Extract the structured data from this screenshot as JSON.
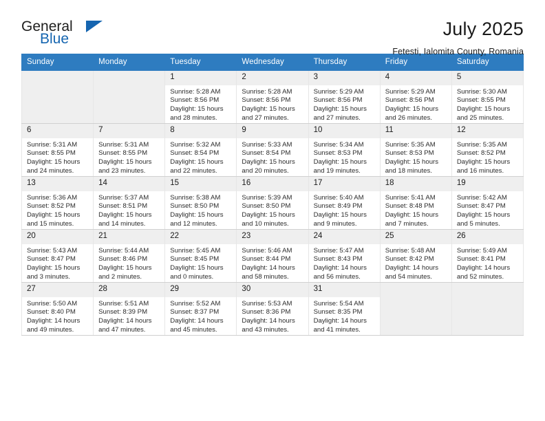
{
  "brand": {
    "line1": "General",
    "line2": "Blue",
    "flag_icon": "triangle-flag-icon",
    "accent_color": "#1565b0"
  },
  "header": {
    "month_title": "July 2025",
    "location": "Fetesti, Ialomita County, Romania"
  },
  "calendar": {
    "header_bg": "#2e7cc0",
    "header_text_color": "#ffffff",
    "weekday_headers": [
      "Sunday",
      "Monday",
      "Tuesday",
      "Wednesday",
      "Thursday",
      "Friday",
      "Saturday"
    ],
    "labels": {
      "sunrise_prefix": "Sunrise:",
      "sunset_prefix": "Sunset:",
      "daylight_prefix": "Daylight:"
    },
    "weeks": [
      [
        {
          "day": "",
          "empty": true
        },
        {
          "day": "",
          "empty": true
        },
        {
          "day": "1",
          "sunrise": "Sunrise: 5:28 AM",
          "sunset": "Sunset: 8:56 PM",
          "daylight_line1": "Daylight: 15 hours",
          "daylight_line2": "and 28 minutes."
        },
        {
          "day": "2",
          "sunrise": "Sunrise: 5:28 AM",
          "sunset": "Sunset: 8:56 PM",
          "daylight_line1": "Daylight: 15 hours",
          "daylight_line2": "and 27 minutes."
        },
        {
          "day": "3",
          "sunrise": "Sunrise: 5:29 AM",
          "sunset": "Sunset: 8:56 PM",
          "daylight_line1": "Daylight: 15 hours",
          "daylight_line2": "and 27 minutes."
        },
        {
          "day": "4",
          "sunrise": "Sunrise: 5:29 AM",
          "sunset": "Sunset: 8:56 PM",
          "daylight_line1": "Daylight: 15 hours",
          "daylight_line2": "and 26 minutes."
        },
        {
          "day": "5",
          "sunrise": "Sunrise: 5:30 AM",
          "sunset": "Sunset: 8:55 PM",
          "daylight_line1": "Daylight: 15 hours",
          "daylight_line2": "and 25 minutes."
        }
      ],
      [
        {
          "day": "6",
          "sunrise": "Sunrise: 5:31 AM",
          "sunset": "Sunset: 8:55 PM",
          "daylight_line1": "Daylight: 15 hours",
          "daylight_line2": "and 24 minutes."
        },
        {
          "day": "7",
          "sunrise": "Sunrise: 5:31 AM",
          "sunset": "Sunset: 8:55 PM",
          "daylight_line1": "Daylight: 15 hours",
          "daylight_line2": "and 23 minutes."
        },
        {
          "day": "8",
          "sunrise": "Sunrise: 5:32 AM",
          "sunset": "Sunset: 8:54 PM",
          "daylight_line1": "Daylight: 15 hours",
          "daylight_line2": "and 22 minutes."
        },
        {
          "day": "9",
          "sunrise": "Sunrise: 5:33 AM",
          "sunset": "Sunset: 8:54 PM",
          "daylight_line1": "Daylight: 15 hours",
          "daylight_line2": "and 20 minutes."
        },
        {
          "day": "10",
          "sunrise": "Sunrise: 5:34 AM",
          "sunset": "Sunset: 8:53 PM",
          "daylight_line1": "Daylight: 15 hours",
          "daylight_line2": "and 19 minutes."
        },
        {
          "day": "11",
          "sunrise": "Sunrise: 5:35 AM",
          "sunset": "Sunset: 8:53 PM",
          "daylight_line1": "Daylight: 15 hours",
          "daylight_line2": "and 18 minutes."
        },
        {
          "day": "12",
          "sunrise": "Sunrise: 5:35 AM",
          "sunset": "Sunset: 8:52 PM",
          "daylight_line1": "Daylight: 15 hours",
          "daylight_line2": "and 16 minutes."
        }
      ],
      [
        {
          "day": "13",
          "sunrise": "Sunrise: 5:36 AM",
          "sunset": "Sunset: 8:52 PM",
          "daylight_line1": "Daylight: 15 hours",
          "daylight_line2": "and 15 minutes."
        },
        {
          "day": "14",
          "sunrise": "Sunrise: 5:37 AM",
          "sunset": "Sunset: 8:51 PM",
          "daylight_line1": "Daylight: 15 hours",
          "daylight_line2": "and 14 minutes."
        },
        {
          "day": "15",
          "sunrise": "Sunrise: 5:38 AM",
          "sunset": "Sunset: 8:50 PM",
          "daylight_line1": "Daylight: 15 hours",
          "daylight_line2": "and 12 minutes."
        },
        {
          "day": "16",
          "sunrise": "Sunrise: 5:39 AM",
          "sunset": "Sunset: 8:50 PM",
          "daylight_line1": "Daylight: 15 hours",
          "daylight_line2": "and 10 minutes."
        },
        {
          "day": "17",
          "sunrise": "Sunrise: 5:40 AM",
          "sunset": "Sunset: 8:49 PM",
          "daylight_line1": "Daylight: 15 hours",
          "daylight_line2": "and 9 minutes."
        },
        {
          "day": "18",
          "sunrise": "Sunrise: 5:41 AM",
          "sunset": "Sunset: 8:48 PM",
          "daylight_line1": "Daylight: 15 hours",
          "daylight_line2": "and 7 minutes."
        },
        {
          "day": "19",
          "sunrise": "Sunrise: 5:42 AM",
          "sunset": "Sunset: 8:47 PM",
          "daylight_line1": "Daylight: 15 hours",
          "daylight_line2": "and 5 minutes."
        }
      ],
      [
        {
          "day": "20",
          "sunrise": "Sunrise: 5:43 AM",
          "sunset": "Sunset: 8:47 PM",
          "daylight_line1": "Daylight: 15 hours",
          "daylight_line2": "and 3 minutes."
        },
        {
          "day": "21",
          "sunrise": "Sunrise: 5:44 AM",
          "sunset": "Sunset: 8:46 PM",
          "daylight_line1": "Daylight: 15 hours",
          "daylight_line2": "and 2 minutes."
        },
        {
          "day": "22",
          "sunrise": "Sunrise: 5:45 AM",
          "sunset": "Sunset: 8:45 PM",
          "daylight_line1": "Daylight: 15 hours",
          "daylight_line2": "and 0 minutes."
        },
        {
          "day": "23",
          "sunrise": "Sunrise: 5:46 AM",
          "sunset": "Sunset: 8:44 PM",
          "daylight_line1": "Daylight: 14 hours",
          "daylight_line2": "and 58 minutes."
        },
        {
          "day": "24",
          "sunrise": "Sunrise: 5:47 AM",
          "sunset": "Sunset: 8:43 PM",
          "daylight_line1": "Daylight: 14 hours",
          "daylight_line2": "and 56 minutes."
        },
        {
          "day": "25",
          "sunrise": "Sunrise: 5:48 AM",
          "sunset": "Sunset: 8:42 PM",
          "daylight_line1": "Daylight: 14 hours",
          "daylight_line2": "and 54 minutes."
        },
        {
          "day": "26",
          "sunrise": "Sunrise: 5:49 AM",
          "sunset": "Sunset: 8:41 PM",
          "daylight_line1": "Daylight: 14 hours",
          "daylight_line2": "and 52 minutes."
        }
      ],
      [
        {
          "day": "27",
          "sunrise": "Sunrise: 5:50 AM",
          "sunset": "Sunset: 8:40 PM",
          "daylight_line1": "Daylight: 14 hours",
          "daylight_line2": "and 49 minutes."
        },
        {
          "day": "28",
          "sunrise": "Sunrise: 5:51 AM",
          "sunset": "Sunset: 8:39 PM",
          "daylight_line1": "Daylight: 14 hours",
          "daylight_line2": "and 47 minutes."
        },
        {
          "day": "29",
          "sunrise": "Sunrise: 5:52 AM",
          "sunset": "Sunset: 8:37 PM",
          "daylight_line1": "Daylight: 14 hours",
          "daylight_line2": "and 45 minutes."
        },
        {
          "day": "30",
          "sunrise": "Sunrise: 5:53 AM",
          "sunset": "Sunset: 8:36 PM",
          "daylight_line1": "Daylight: 14 hours",
          "daylight_line2": "and 43 minutes."
        },
        {
          "day": "31",
          "sunrise": "Sunrise: 5:54 AM",
          "sunset": "Sunset: 8:35 PM",
          "daylight_line1": "Daylight: 14 hours",
          "daylight_line2": "and 41 minutes."
        },
        {
          "day": "",
          "empty": true
        },
        {
          "day": "",
          "empty": true
        }
      ]
    ]
  }
}
